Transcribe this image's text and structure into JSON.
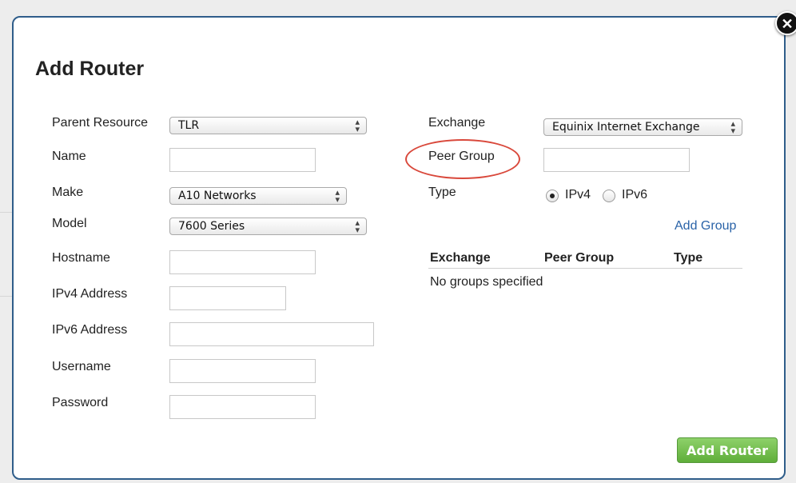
{
  "modal": {
    "title": "Add Router",
    "close_icon": "close-icon",
    "submit_label": "Add Router"
  },
  "left_form": {
    "parent_resource": {
      "label": "Parent Resource",
      "value": "TLR"
    },
    "name": {
      "label": "Name",
      "value": ""
    },
    "make": {
      "label": "Make",
      "value": "A10 Networks"
    },
    "model": {
      "label": "Model",
      "value": "7600 Series"
    },
    "hostname": {
      "label": "Hostname",
      "value": ""
    },
    "ipv4": {
      "label": "IPv4 Address",
      "value": ""
    },
    "ipv6": {
      "label": "IPv6 Address",
      "value": ""
    },
    "username": {
      "label": "Username",
      "value": ""
    },
    "password": {
      "label": "Password",
      "value": ""
    }
  },
  "right_form": {
    "exchange": {
      "label": "Exchange",
      "value": "Equinix Internet Exchange"
    },
    "peer_group": {
      "label": "Peer Group",
      "value": ""
    },
    "type": {
      "label": "Type",
      "options": [
        "IPv4",
        "IPv6"
      ],
      "selected": "IPv4"
    },
    "add_group_label": "Add Group"
  },
  "groups_table": {
    "columns": [
      "Exchange",
      "Peer Group",
      "Type"
    ],
    "empty_text": "No groups specified"
  },
  "colors": {
    "modal_border": "#2f5d8a",
    "link": "#2a63a8",
    "submit_green": "#6dbb45",
    "highlight_ring": "#d9483b"
  }
}
